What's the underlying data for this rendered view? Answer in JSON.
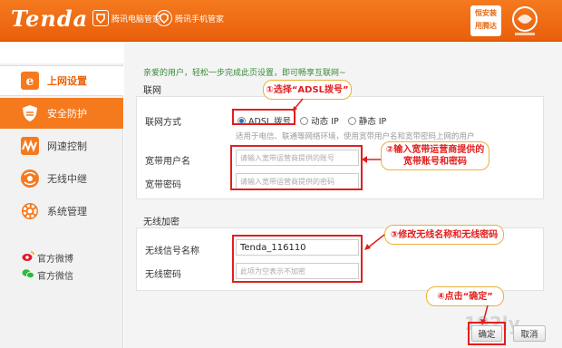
{
  "header": {
    "brand": "Tenda",
    "partners": [
      {
        "label": "腾讯电脑管家",
        "icon": "tencent-pc-manager-icon"
      },
      {
        "label": "腾讯手机管家",
        "icon": "tencent-phone-manager-icon"
      }
    ],
    "safe_badge": [
      "恒安装",
      "用腾达"
    ]
  },
  "sidebar": {
    "items": [
      {
        "label": "上网设置",
        "icon": "internet-explorer-icon"
      },
      {
        "label": "安全防护",
        "icon": "shield-icon"
      },
      {
        "label": "网速控制",
        "icon": "speed-wave-icon"
      },
      {
        "label": "无线中继",
        "icon": "wireless-relay-icon"
      },
      {
        "label": "系统管理",
        "icon": "gear-icon"
      }
    ],
    "social": [
      {
        "label": "官方微博",
        "icon": "weibo-icon"
      },
      {
        "label": "官方微信",
        "icon": "wechat-icon"
      }
    ]
  },
  "main": {
    "intro": "亲爱的用户，轻松一步完成此页设置，即可畅享互联网~",
    "wan_section_title": "联网",
    "connection_type_label": "联网方式",
    "connection_options": [
      "ADSL 拨号",
      "动态 IP",
      "静态 IP"
    ],
    "connection_selected": "ADSL 拨号",
    "connection_hint": "适用于电信、联通等网络环境，使用宽带用户名和宽带密码上网的用户",
    "username_label": "宽带用户名",
    "username_placeholder": "请输入宽带运营商提供的账号",
    "password_label": "宽带密码",
    "password_placeholder": "请输入宽带运营商提供的密码",
    "wireless_section_title": "无线加密",
    "ssid_label": "无线信号名称",
    "ssid_value": "Tenda_116110",
    "wifi_password_label": "无线密码",
    "wifi_password_placeholder": "此项为空表示不加密",
    "ok_label": "确定",
    "cancel_label": "取消"
  },
  "annotations": {
    "step1": "①选择“ADSL拨号”",
    "step2": "②输入宽带运营商提供的宽带账号和密码",
    "step3": "③修改无线名称和无线密码",
    "step4": "④点击“确定”"
  },
  "colors": {
    "accent": "#f57a1e",
    "annotation_red": "#e21f1f",
    "intro_green": "#3a8a3a"
  }
}
